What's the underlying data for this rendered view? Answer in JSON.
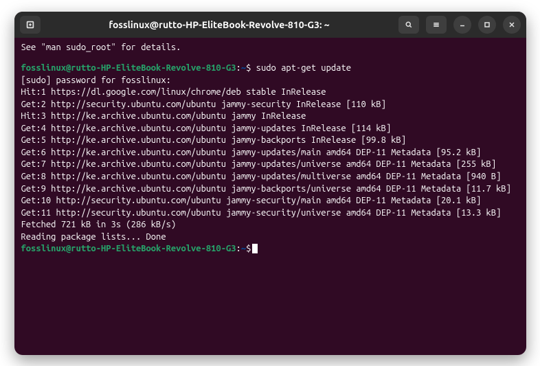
{
  "titlebar": {
    "title": "fosslinux@rutto-HP-EliteBook-Revolve-810-G3: ~"
  },
  "prompt": {
    "user_host": "fosslinux@rutto-HP-EliteBook-Revolve-810-G3",
    "colon": ":",
    "path": "~",
    "symbol": "$"
  },
  "lines": {
    "intro": "See \"man sudo_root\" for details.",
    "cmd1": " sudo apt-get update",
    "sudo": "[sudo] password for fosslinux:",
    "out1": "Hit:1 https://dl.google.com/linux/chrome/deb stable InRelease",
    "out2": "Get:2 http://security.ubuntu.com/ubuntu jammy-security InRelease [110 kB]",
    "out3": "Hit:3 http://ke.archive.ubuntu.com/ubuntu jammy InRelease",
    "out4": "Get:4 http://ke.archive.ubuntu.com/ubuntu jammy-updates InRelease [114 kB]",
    "out5": "Get:5 http://ke.archive.ubuntu.com/ubuntu jammy-backports InRelease [99.8 kB]",
    "out6": "Get:6 http://ke.archive.ubuntu.com/ubuntu jammy-updates/main amd64 DEP-11 Metadata [95.2 kB]",
    "out7": "Get:7 http://ke.archive.ubuntu.com/ubuntu jammy-updates/universe amd64 DEP-11 Metadata [255 kB]",
    "out8": "Get:8 http://ke.archive.ubuntu.com/ubuntu jammy-updates/multiverse amd64 DEP-11 Metadata [940 B]",
    "out9": "Get:9 http://ke.archive.ubuntu.com/ubuntu jammy-backports/universe amd64 DEP-11 Metadata [11.7 kB]",
    "out10": "Get:10 http://security.ubuntu.com/ubuntu jammy-security/main amd64 DEP-11 Metadata [20.1 kB]",
    "out11": "Get:11 http://security.ubuntu.com/ubuntu jammy-security/universe amd64 DEP-11 Metadata [13.3 kB]",
    "fetched": "Fetched 721 kB in 3s (286 kB/s)",
    "reading": "Reading package lists... Done"
  }
}
